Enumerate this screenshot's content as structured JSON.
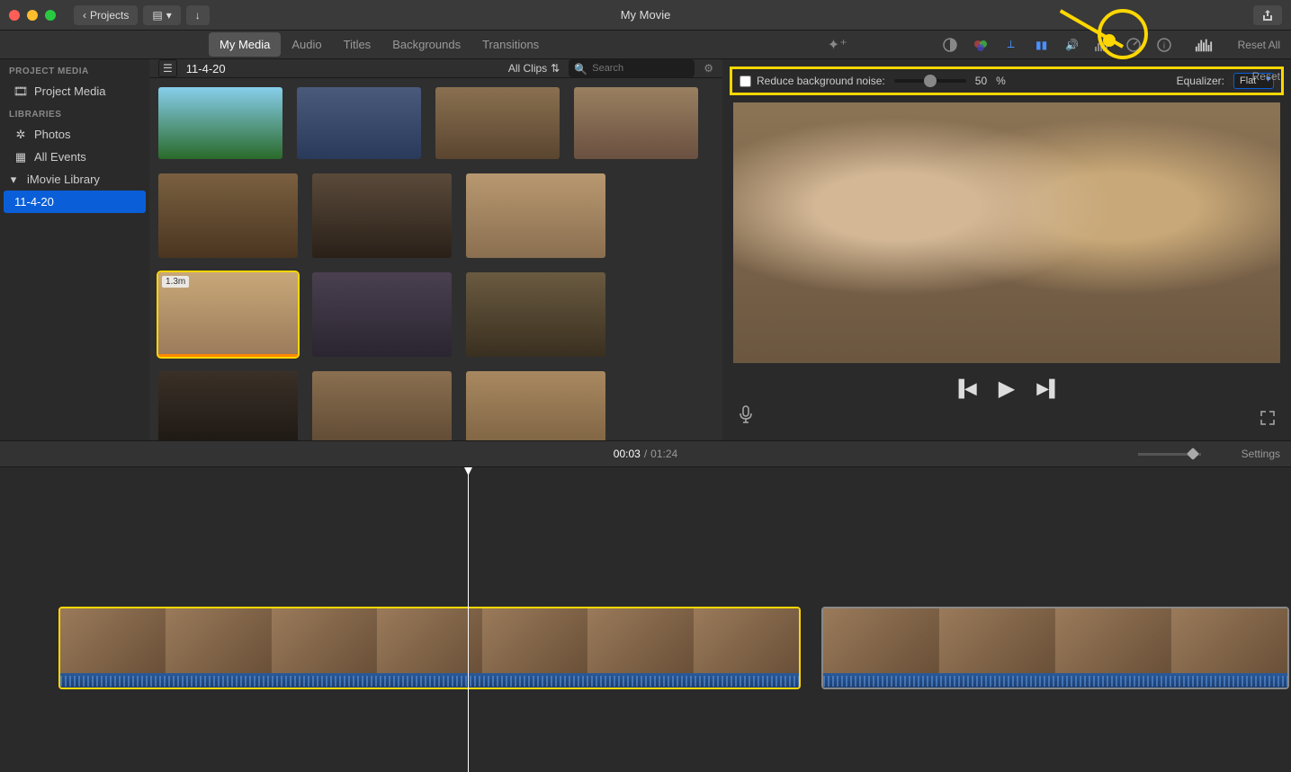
{
  "title": "My Movie",
  "toolbar": {
    "projects": "Projects"
  },
  "tabs": [
    "My Media",
    "Audio",
    "Titles",
    "Backgrounds",
    "Transitions"
  ],
  "activeTab": 0,
  "sidebar": {
    "sections": [
      {
        "header": "PROJECT MEDIA",
        "items": [
          {
            "label": "Project Media",
            "icon": "film"
          }
        ]
      },
      {
        "header": "LIBRARIES",
        "items": [
          {
            "label": "Photos",
            "icon": "photos"
          },
          {
            "label": "All Events",
            "icon": "grid"
          }
        ]
      },
      {
        "header": "",
        "items": [
          {
            "label": "iMovie Library",
            "icon": "tri",
            "tree": true
          },
          {
            "label": "11-4-20",
            "selected": true
          }
        ]
      }
    ]
  },
  "browser": {
    "date": "11-4-20",
    "filter": "All Clips",
    "searchPlaceholder": "Search",
    "clipBadge": "1.3m"
  },
  "noiseReduction": {
    "label": "Reduce background noise:",
    "value": "50",
    "unit": "%",
    "eqLabel": "Equalizer:",
    "eqValue": "Flat",
    "reset": "Reset"
  },
  "resetAll": "Reset All",
  "playback": {
    "current": "00:03",
    "total": "01:24"
  },
  "settings": "Settings"
}
